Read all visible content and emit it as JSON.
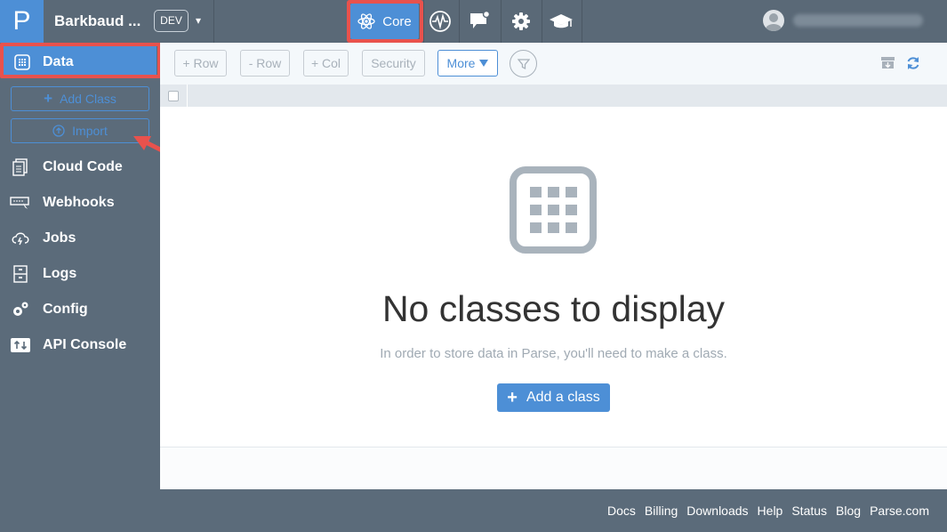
{
  "header": {
    "logo_letter": "P",
    "app_name": "Barkbaud ...",
    "env_label": "DEV",
    "env_caret": "▾",
    "nav_core_label": "Core",
    "icons": [
      "core-atom-icon",
      "analytics-pulse-icon",
      "push-chat-icon",
      "settings-gear-icon",
      "docs-mortarboard-icon"
    ],
    "user_avatar": "user-avatar-icon"
  },
  "sidebar": {
    "data_label": "Data",
    "add_class_label": "Add Class",
    "import_label": "Import",
    "items": [
      {
        "label": "Cloud Code",
        "icon": "cloud-code-icon"
      },
      {
        "label": "Webhooks",
        "icon": "webhooks-icon"
      },
      {
        "label": "Jobs",
        "icon": "jobs-icon"
      },
      {
        "label": "Logs",
        "icon": "logs-icon"
      },
      {
        "label": "Config",
        "icon": "config-icon"
      },
      {
        "label": "API Console",
        "icon": "api-console-icon"
      }
    ]
  },
  "toolbar": {
    "add_row": "+ Row",
    "remove_row": "- Row",
    "add_col": "+ Col",
    "security": "Security",
    "more": "More"
  },
  "main": {
    "empty_title": "No classes to display",
    "empty_subtitle": "In order to store data in Parse, you'll need to make a class.",
    "add_class_label": "Add a class"
  },
  "footer": {
    "links": [
      "Docs",
      "Billing",
      "Downloads",
      "Help",
      "Status",
      "Blog",
      "Parse.com"
    ]
  },
  "colors": {
    "accent": "#4d8fd6",
    "highlight": "#e8524d",
    "chrome": "#5b6b7a"
  }
}
